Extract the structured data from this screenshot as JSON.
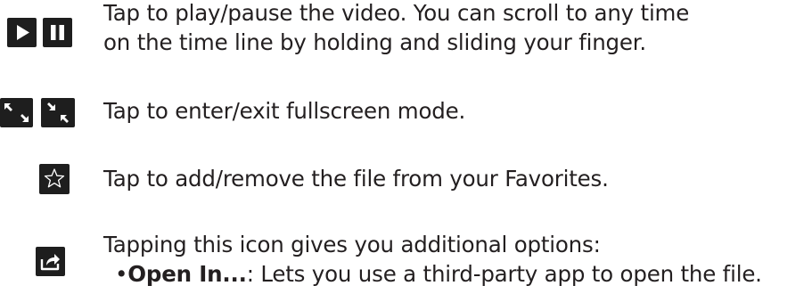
{
  "rows": [
    {
      "icons": [
        "play-icon",
        "pause-icon"
      ],
      "lines": [
        "Tap to play/pause the video. You can scroll to any time",
        "on the time line by holding and sliding your finger."
      ]
    },
    {
      "icons": [
        "enter-fullscreen-icon",
        "exit-fullscreen-icon"
      ],
      "lines": [
        "Tap to enter/exit fullscreen mode."
      ]
    },
    {
      "icons": [
        "star-icon"
      ],
      "lines": [
        "Tap to add/remove the file from your Favorites."
      ]
    },
    {
      "icons": [
        "share-icon"
      ],
      "lines": [
        "Tapping this icon gives you additional options:"
      ],
      "bullet": {
        "symbol": "•",
        "bold": "Open In...",
        "rest": ": Lets you use a third-party app to open the file."
      }
    }
  ],
  "colors": {
    "text": "#231f20",
    "icon_bg": "#1e1e1e",
    "icon_fg": "#ffffff"
  }
}
